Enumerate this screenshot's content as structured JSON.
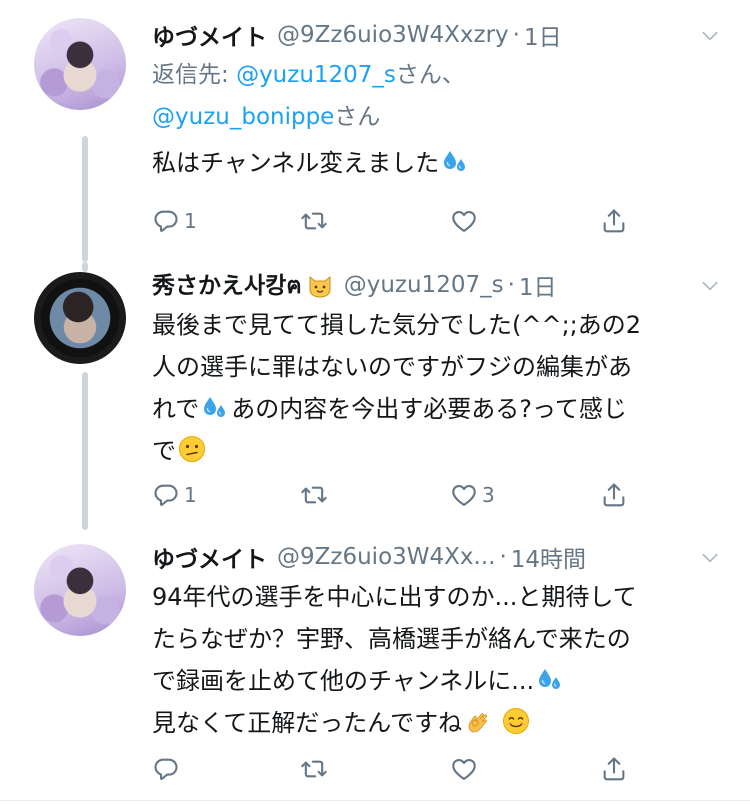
{
  "tweets": [
    {
      "name": "ゆづメイト",
      "handle": "@9Zz6uio3W4Xxzry",
      "sep": "·",
      "time": "1日",
      "reply_prefix": "返信先: ",
      "reply_mention1": "@yuzu1207_s",
      "reply_suffix1": "さん、",
      "reply_mention2": "@yuzu_bonippe",
      "reply_suffix2": "さん",
      "text": "私はチャンネル変えました",
      "reply_count": "1",
      "like_count": ""
    },
    {
      "name": "秀さかえ사캉ฅ",
      "handle": "@yuzu1207_s",
      "sep": "·",
      "time": "1日",
      "text_line1": "最後まで見てて損した気分でした(^^;;あの2",
      "text_line2": "人の選手に罪はないのですがフジの編集があ",
      "text_line3a": "れで",
      "text_line3b": "あの内容を今出す必要ある?って感じ",
      "text_line4": "で",
      "reply_count": "1",
      "like_count": "3"
    },
    {
      "name": "ゆづメイト",
      "handle": "@9Zz6uio3W4Xx...",
      "sep": "·",
      "time": "14時間",
      "text_line1": "94年代の選手を中心に出すのか...と期待して",
      "text_line2": "たらなぜか？宇野、高橋選手が絡んで来たの",
      "text_line3": "で録画を止めて他のチャンネルに...",
      "text_line4": "見なくて正解だったんですね",
      "reply_count": "",
      "like_count": ""
    }
  ],
  "icons": {
    "reply": "reply-icon",
    "retweet": "retweet-icon",
    "like": "heart-icon",
    "share": "share-icon",
    "more": "chevron-down-icon"
  },
  "colors": {
    "link": "#1da1f2",
    "muted": "#657786",
    "text": "#14171a",
    "thread_line": "#cdd6dd"
  }
}
